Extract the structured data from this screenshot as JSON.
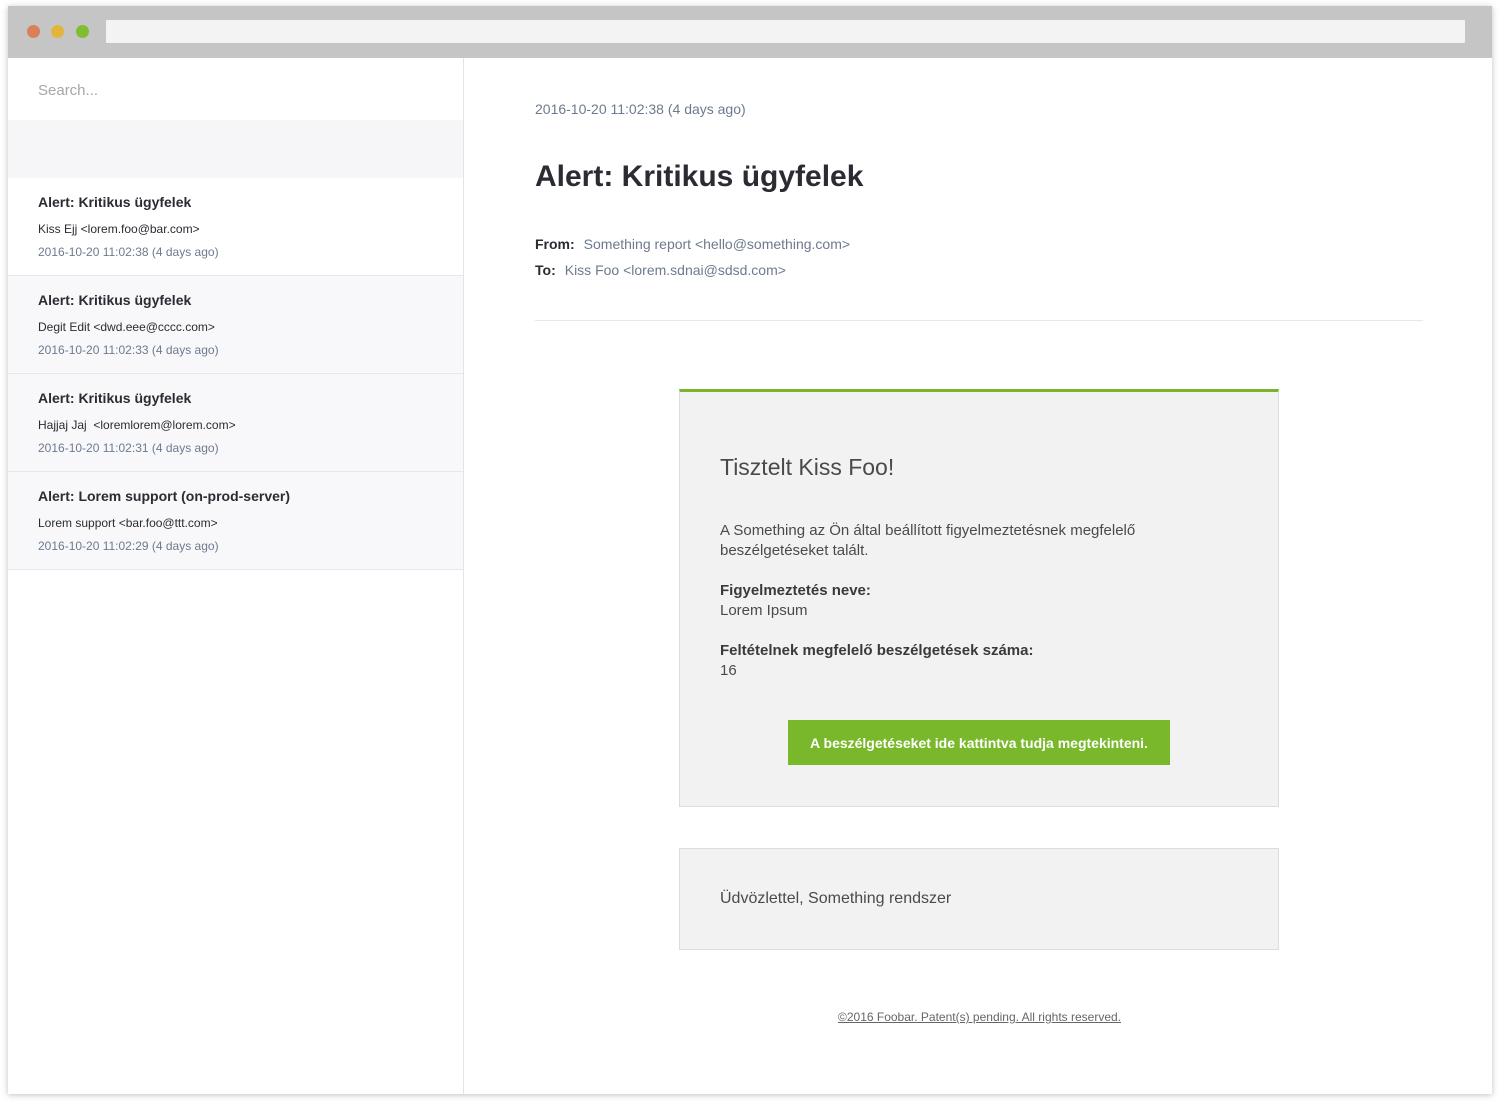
{
  "colors": {
    "traffic_red": "#d9805a",
    "traffic_yellow": "#e2b63c",
    "traffic_green": "#80bd32",
    "accent_green": "#78b82a",
    "muted_blue_gray": "#6d7a8e"
  },
  "search": {
    "placeholder": "Search..."
  },
  "mail_list": [
    {
      "subject": "Alert: Kritikus ügyfelek",
      "from": "Kiss Ejj <lorem.foo@bar.com>",
      "date": "2016-10-20 11:02:38 (4 days ago)",
      "selected": true
    },
    {
      "subject": "Alert: Kritikus ügyfelek",
      "from": "Degit Edit <dwd.eee@cccc.com>",
      "date": "2016-10-20 11:02:33 (4 days ago)",
      "selected": false
    },
    {
      "subject": "Alert: Kritikus ügyfelek",
      "from": "Hajjaj Jaj  <loremlorem@lorem.com>",
      "date": "2016-10-20 11:02:31 (4 days ago)",
      "selected": false
    },
    {
      "subject": "Alert: Lorem support (on-prod-server)",
      "from": "Lorem support <bar.foo@ttt.com>",
      "date": "2016-10-20 11:02:29 (4 days ago)",
      "selected": false
    }
  ],
  "message": {
    "date": "2016-10-20 11:02:38 (4 days ago)",
    "subject": "Alert: Kritikus ügyfelek",
    "from_label": "From:",
    "from_value": "Something report <hello@something.com>",
    "to_label": "To:",
    "to_value": "Kiss Foo <lorem.sdnai@sdsd.com>"
  },
  "email_body": {
    "greeting": "Tisztelt Kiss Foo!",
    "intro": "A Something az Ön által beállított figyelmeztetésnek megfelelő beszélgetéseket talált.",
    "alert_name_label": "Figyelmeztetés neve:",
    "alert_name_value": "Lorem Ipsum",
    "count_label": "Feltételnek megfelelő beszélgetések száma:",
    "count_value": "16",
    "cta_label": "A beszélgetéseket ide kattintva tudja megtekinteni.",
    "signoff": "Üdvözlettel, Something rendszer",
    "footer": "©2016 Foobar. Patent(s) pending. All rights reserved."
  }
}
